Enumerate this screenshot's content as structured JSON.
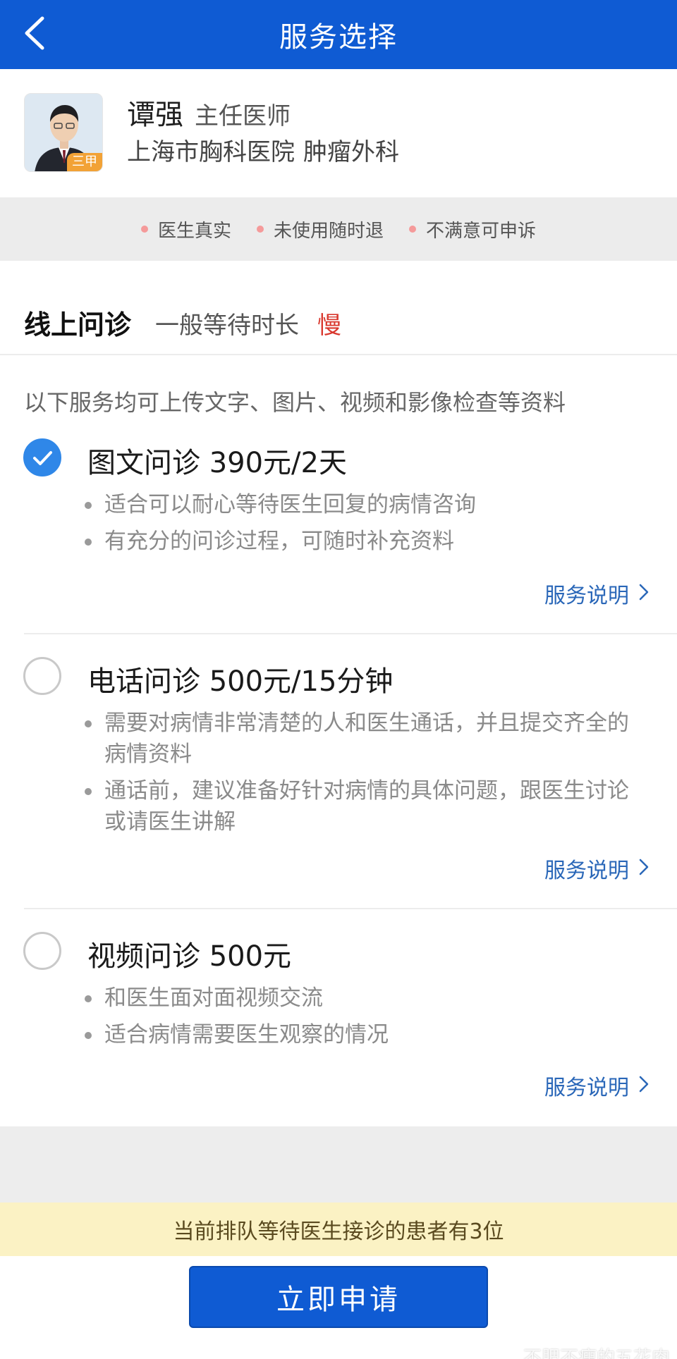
{
  "header": {
    "title": "服务选择"
  },
  "doctor": {
    "name": "谭强",
    "title": "主任医师",
    "hospital": "上海市胸科医院",
    "department": "肿瘤外科",
    "rank_badge": "三甲"
  },
  "guarantees": [
    "医生真实",
    "未使用随时退",
    "不满意可申诉"
  ],
  "section": {
    "title": "线上问诊",
    "wait_label": "一般等待时长",
    "wait_speed": "慢"
  },
  "note": "以下服务均可上传文字、图片、视频和影像检查等资料",
  "options": [
    {
      "title": "图文问诊  390元/2天",
      "selected": true,
      "bullets": [
        "适合可以耐心等待医生回复的病情咨询",
        "有充分的问诊过程，可随时补充资料"
      ],
      "link": "服务说明"
    },
    {
      "title": "电话问诊  500元/15分钟",
      "selected": false,
      "bullets": [
        "需要对病情非常清楚的人和医生通话，并且提交齐全的病情资料",
        "通话前，建议准备好针对病情的具体问题，跟医生讨论或请医生讲解"
      ],
      "link": "服务说明"
    },
    {
      "title": "视频问诊  500元",
      "selected": false,
      "bullets": [
        "和医生面对面视频交流",
        "适合病情需要医生观察的情况"
      ],
      "link": "服务说明"
    }
  ],
  "queue_text": "当前排队等待医生接诊的患者有3位",
  "apply_button": "立即申请",
  "watermark": "不肥不瘦的五花肉",
  "colors": {
    "primary": "#0f5bd3",
    "selected": "#2f87e8",
    "accent_red": "#d9382e",
    "link": "#2a67b8"
  },
  "icons": {
    "back": "chevron-left-icon",
    "check": "check-icon",
    "link_chevron": "chevron-right-icon"
  }
}
